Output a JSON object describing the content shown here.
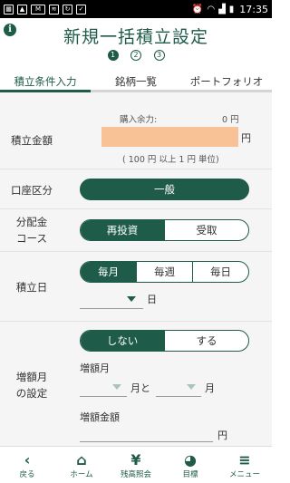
{
  "status": {
    "time": "17:35"
  },
  "header": {
    "title": "新規一括積立設定",
    "steps": [
      "1",
      "2",
      "3"
    ]
  },
  "tabs": [
    {
      "label": "積立条件入力",
      "active": true
    },
    {
      "label": "銘柄一覧",
      "active": false
    },
    {
      "label": "ポートフォリオ",
      "active": false
    }
  ],
  "amount": {
    "label": "積立金額",
    "available_label": "購入余力:",
    "available_value": "0 円",
    "value": "",
    "unit": "円",
    "note": "( 100 円 以上 1 円 単位)"
  },
  "account": {
    "label": "口座区分",
    "option": "一般"
  },
  "dividend": {
    "label_line1": "分配金",
    "label_line2": "コース",
    "options": [
      "再投資",
      "受取"
    ],
    "selected": 0
  },
  "date": {
    "label": "積立日",
    "options": [
      "毎月",
      "毎週",
      "毎日"
    ],
    "selected": 0,
    "day_unit": "日"
  },
  "increase": {
    "label_line1": "増額月",
    "label_line2": "の設定",
    "options": [
      "しない",
      "する"
    ],
    "selected": 0,
    "month_label": "増額月",
    "month_unit_and": "月と",
    "month_unit": "月",
    "amount_label": "増額金額",
    "amount_unit": "円"
  },
  "nav": [
    {
      "label": "戻る",
      "icon": "back-icon"
    },
    {
      "label": "ホーム",
      "icon": "home-icon"
    },
    {
      "label": "残高照会",
      "icon": "yen-icon"
    },
    {
      "label": "目標",
      "icon": "pie-chart-icon"
    },
    {
      "label": "メニュー",
      "icon": "menu-icon"
    }
  ]
}
